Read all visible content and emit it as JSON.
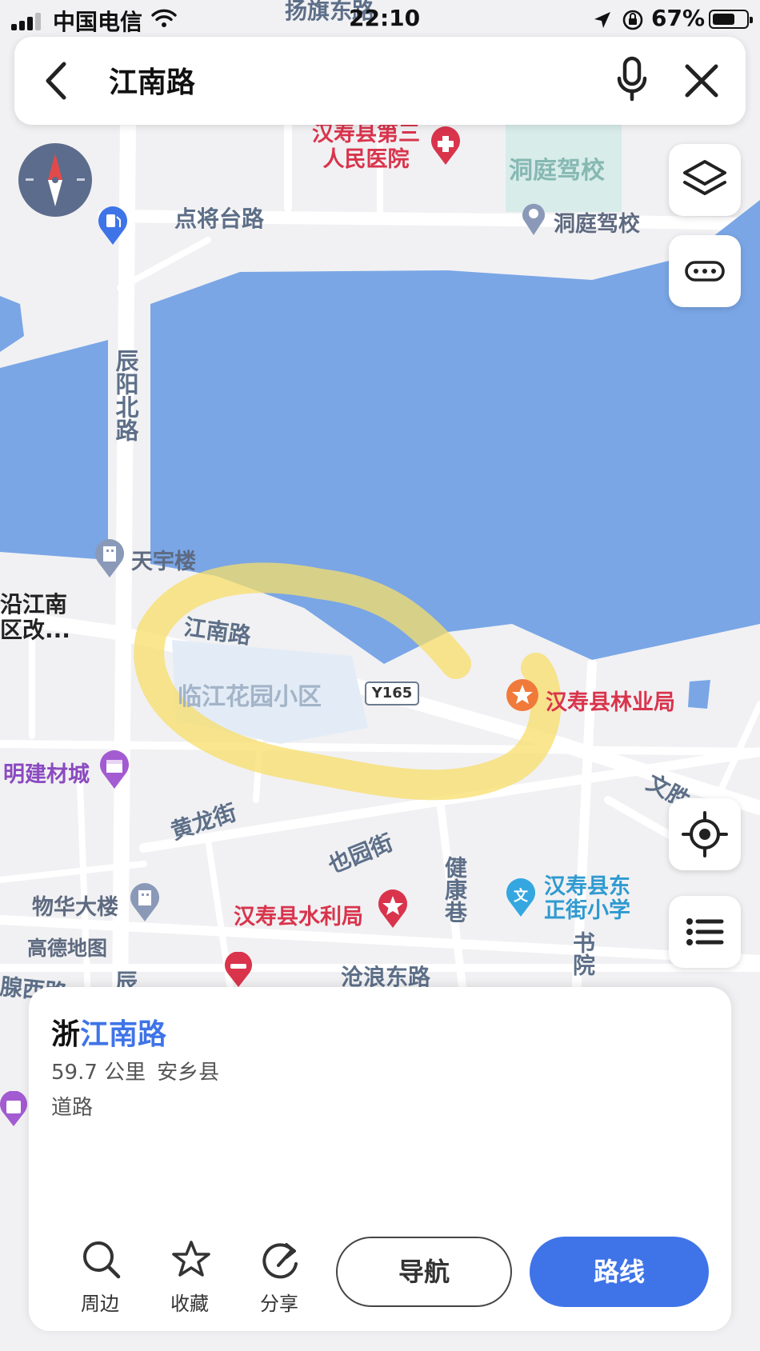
{
  "status_bar": {
    "carrier": "中国电信",
    "time": "22:10",
    "battery_percent": "67%",
    "battery_level": 0.67,
    "top_road_label": "扬旗东路"
  },
  "search": {
    "query": "江南路",
    "back_icon": "chevron-left-icon",
    "mic_icon": "microphone-icon",
    "clear_icon": "close-icon"
  },
  "map": {
    "road_labels": {
      "dianjiangtai": "点将台路",
      "chenyang": "辰阳北路",
      "jiangnan": "江南路",
      "huanglong": "黄龙街",
      "yeyuan": "也园街",
      "jiankang": "健康巷",
      "canglang": "沧浪东路",
      "shuyuan": "书院",
      "wensheng": "文胜",
      "chen_bottom": "辰",
      "xilu_bottom": "腺西路",
      "route_badge": "Y165"
    },
    "pois": {
      "hospital": "汉寿县第三人民医院",
      "hospital_line1": "汉寿县第三",
      "hospital_line2": "人民医院",
      "driving_school_area": "洞庭驾校",
      "driving_school": "洞庭驾校",
      "tianyu": "天宇楼",
      "yanjiang_line1": "沿江南",
      "yanjiang_line2": "区改...",
      "garden": "临江花园小区",
      "forestry": "汉寿县林业局",
      "building_mall": "明建材城",
      "wuhua": "物华大楼",
      "gaode": "高德地图",
      "water": "汉寿县水利局",
      "school_line1": "汉寿县东",
      "school_line2": "正街小学"
    },
    "colors": {
      "water": "#7aa6e6",
      "highlight": "#f7de6a",
      "accent": "#3f74e8",
      "poi_red": "#d9344c"
    }
  },
  "controls": {
    "compass_icon": "compass-icon",
    "layers_icon": "layers-icon",
    "more_icon": "more-dots-icon",
    "locate_icon": "locate-icon",
    "list_icon": "list-icon"
  },
  "result": {
    "title_prefix": "浙",
    "title_match": "江南路",
    "distance": "59.7 公里",
    "region": "安乡县",
    "type": "道路",
    "actions": [
      {
        "label": "周边",
        "icon": "search-icon"
      },
      {
        "label": "收藏",
        "icon": "star-icon"
      },
      {
        "label": "分享",
        "icon": "share-icon"
      }
    ],
    "navigate_label": "导航",
    "route_label": "路线"
  }
}
